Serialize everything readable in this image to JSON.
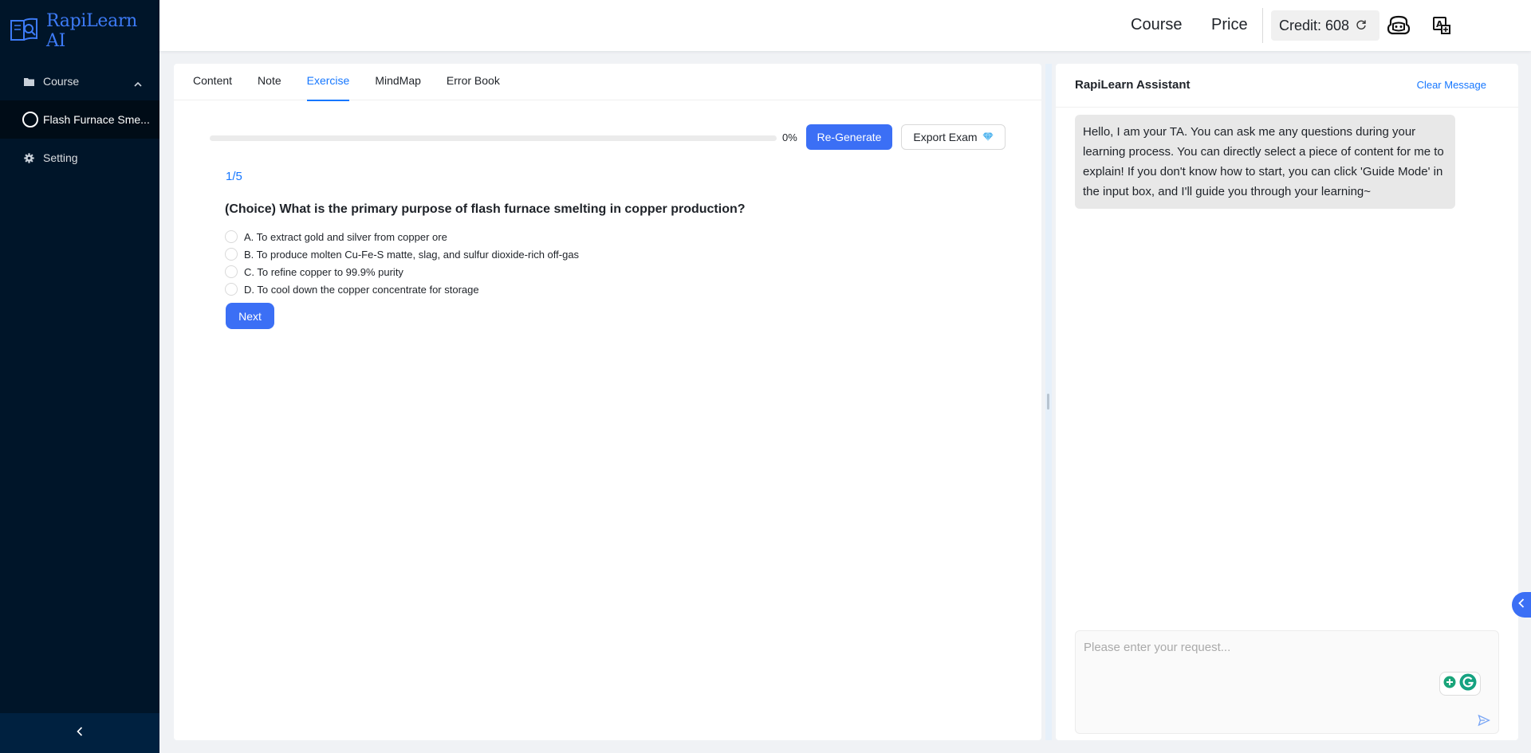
{
  "app": {
    "name": "RapiLearn AI",
    "accent": "#1677ff",
    "sidebar_bg": "#001529"
  },
  "sidebar": {
    "items": [
      {
        "label": "Course",
        "icon": "folder-icon",
        "expanded": true
      },
      {
        "label": "Setting",
        "icon": "gear-icon"
      }
    ],
    "sub_items": [
      {
        "label": "Flash Furnace Sme...",
        "icon": "circle-icon",
        "selected": true
      }
    ],
    "collapse_icon": "chevron-left-icon"
  },
  "header": {
    "links": [
      "Course",
      "Price"
    ],
    "credit_label": "Credit: 608",
    "icons": [
      "refresh-icon",
      "robot-icon",
      "translate-icon"
    ]
  },
  "main": {
    "tabs": [
      "Content",
      "Note",
      "Exercise",
      "MindMap",
      "Error Book"
    ],
    "active_tab": "Exercise",
    "progress": {
      "percent": 0,
      "label": "0%"
    },
    "regenerate_label": "Re-Generate",
    "export_label": "Export Exam",
    "export_icon": "diamond-icon",
    "question": {
      "index": "1/5",
      "text": "(Choice) What is the primary purpose of flash furnace smelting in copper production?",
      "options": [
        "A. To extract gold and silver from copper ore",
        "B. To produce molten Cu-Fe-S matte, slag, and sulfur dioxide-rich off-gas",
        "C. To refine copper to 99.9% purity",
        "D. To cool down the copper concentrate for storage"
      ]
    },
    "next_label": "Next"
  },
  "assistant": {
    "title": "RapiLearn Assistant",
    "clear_label": "Clear Message",
    "messages": [
      {
        "role": "assistant",
        "text": "Hello, I am your TA. You can ask me any questions during your learning process. You can directly select a piece of content for me to explain! If you don't know how to start, you can click 'Guide Mode' in the input box, and I'll guide you through your learning~"
      }
    ],
    "input_placeholder": "Please enter your request...",
    "input_value": "",
    "icons": [
      "bulb-plus-icon",
      "grammarly-icon",
      "send-icon"
    ]
  },
  "edge_toggle_icon": "chevron-left-icon"
}
